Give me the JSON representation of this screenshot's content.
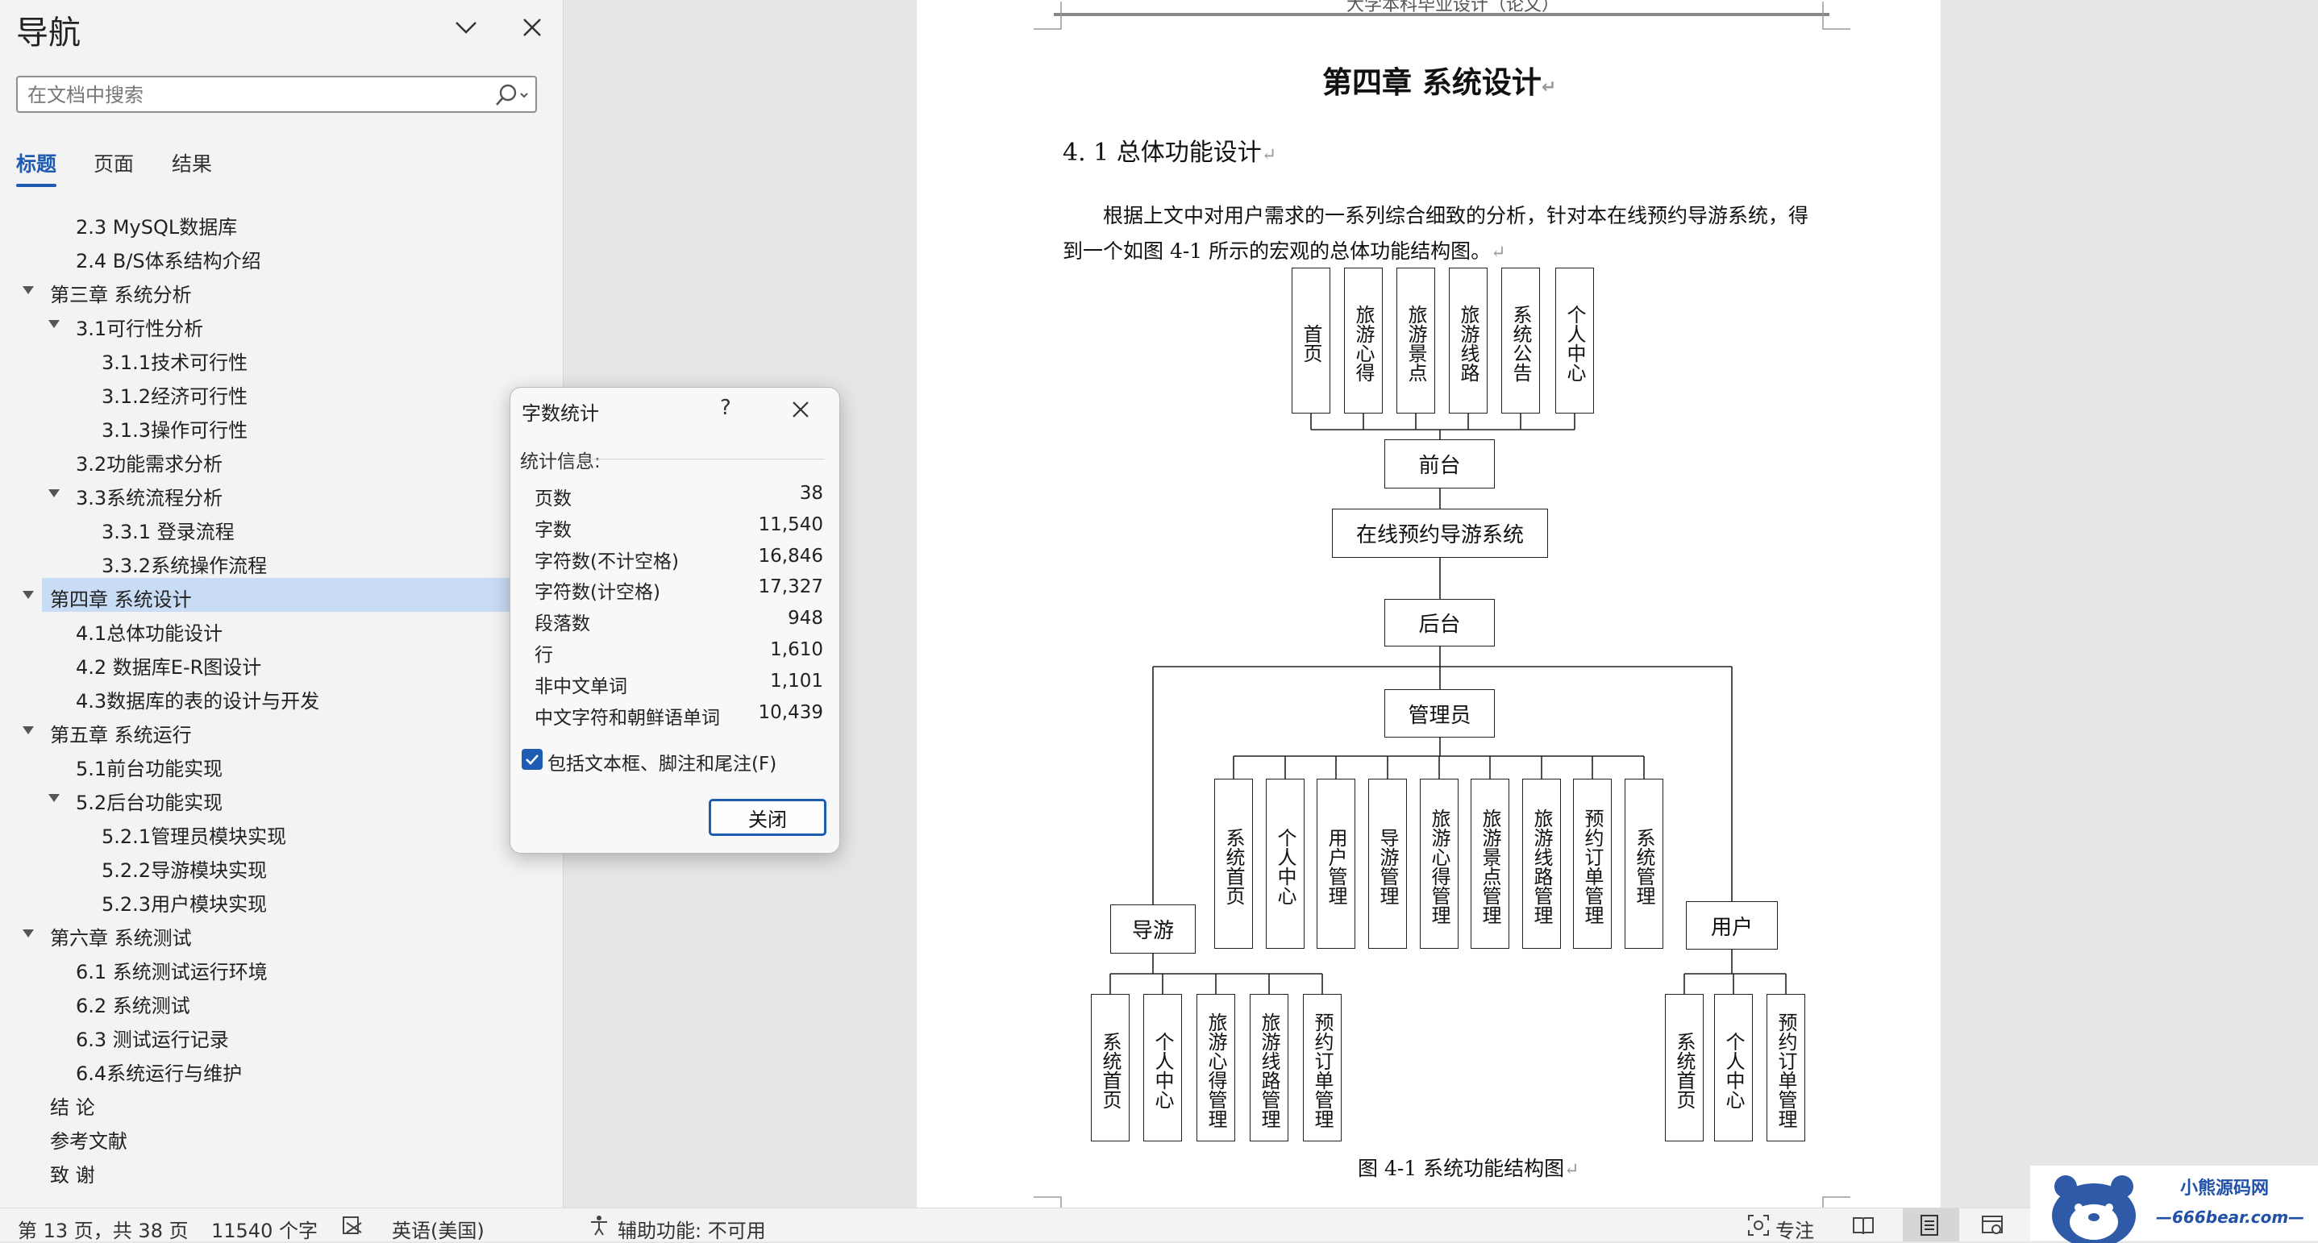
{
  "nav": {
    "title": "导航",
    "search_placeholder": "在文档中搜索",
    "tabs": [
      "标题",
      "页面",
      "结果"
    ],
    "headings": [
      {
        "text": "2.3 MySQL数据库",
        "level": 2,
        "toggle": false,
        "selected": false
      },
      {
        "text": "2.4 B/S体系结构介绍",
        "level": 2,
        "toggle": false,
        "selected": false
      },
      {
        "text": "第三章 系统分析",
        "level": 1,
        "toggle": true,
        "selected": false
      },
      {
        "text": "3.1可行性分析",
        "level": 2,
        "toggle": true,
        "selected": false
      },
      {
        "text": "3.1.1技术可行性",
        "level": 3,
        "toggle": false,
        "selected": false
      },
      {
        "text": "3.1.2经济可行性",
        "level": 3,
        "toggle": false,
        "selected": false
      },
      {
        "text": "3.1.3操作可行性",
        "level": 3,
        "toggle": false,
        "selected": false
      },
      {
        "text": "3.2功能需求分析",
        "level": 2,
        "toggle": false,
        "selected": false
      },
      {
        "text": "3.3系统流程分析",
        "level": 2,
        "toggle": true,
        "selected": false
      },
      {
        "text": "3.3.1 登录流程",
        "level": 3,
        "toggle": false,
        "selected": false
      },
      {
        "text": "3.3.2系统操作流程",
        "level": 3,
        "toggle": false,
        "selected": false
      },
      {
        "text": "第四章 系统设计",
        "level": 1,
        "toggle": true,
        "selected": true
      },
      {
        "text": "4.1总体功能设计",
        "level": 2,
        "toggle": false,
        "selected": false
      },
      {
        "text": "4.2 数据库E-R图设计",
        "level": 2,
        "toggle": false,
        "selected": false
      },
      {
        "text": "4.3数据库的表的设计与开发",
        "level": 2,
        "toggle": false,
        "selected": false
      },
      {
        "text": "第五章 系统运行",
        "level": 1,
        "toggle": true,
        "selected": false
      },
      {
        "text": "5.1前台功能实现",
        "level": 2,
        "toggle": false,
        "selected": false
      },
      {
        "text": "5.2后台功能实现",
        "level": 2,
        "toggle": true,
        "selected": false
      },
      {
        "text": "5.2.1管理员模块实现",
        "level": 3,
        "toggle": false,
        "selected": false
      },
      {
        "text": "5.2.2导游模块实现",
        "level": 3,
        "toggle": false,
        "selected": false
      },
      {
        "text": "5.2.3用户模块实现",
        "level": 3,
        "toggle": false,
        "selected": false
      },
      {
        "text": "第六章 系统测试",
        "level": 1,
        "toggle": true,
        "selected": false
      },
      {
        "text": "6.1 系统测试运行环境",
        "level": 2,
        "toggle": false,
        "selected": false
      },
      {
        "text": "6.2 系统测试",
        "level": 2,
        "toggle": false,
        "selected": false
      },
      {
        "text": "6.3 测试运行记录",
        "level": 2,
        "toggle": false,
        "selected": false
      },
      {
        "text": "6.4系统运行与维护",
        "level": 2,
        "toggle": false,
        "selected": false
      },
      {
        "text": "结 论",
        "level": 1,
        "toggle": false,
        "selected": false
      },
      {
        "text": "参考文献",
        "level": 1,
        "toggle": false,
        "selected": false
      },
      {
        "text": "致 谢",
        "level": 1,
        "toggle": false,
        "selected": false
      }
    ]
  },
  "document": {
    "running_header": "大学本科毕业设计（论文）",
    "chapter_title": "第四章  系统设计",
    "section_title": "4. 1 总体功能设计",
    "paragraph": "根据上文中对用户需求的一系列综合细致的分析，针对本在线预约导游系统，得到一个如图 4-1 所示的宏观的总体功能结构图。",
    "figure_caption": "图 4-1  系统功能结构图",
    "return_mark": "↵"
  },
  "diagram": {
    "front_items": [
      "首页",
      "旅游心得",
      "旅游景点",
      "旅游线路",
      "系统公告",
      "个人中心"
    ],
    "front": "前台",
    "system": "在线预约导游系统",
    "back": "后台",
    "admin": "管理员",
    "admin_items": [
      "系统首页",
      "个人中心",
      "用户管理",
      "导游管理",
      "旅游心得管理",
      "旅游景点管理",
      "旅游线路管理",
      "预约订单管理",
      "系统管理"
    ],
    "guide": "导游",
    "guide_items": [
      "系统首页",
      "个人中心",
      "旅游心得管理",
      "旅游线路管理",
      "预约订单管理"
    ],
    "user": "用户",
    "user_items": [
      "系统首页",
      "个人中心",
      "预约订单管理"
    ]
  },
  "dialog": {
    "title": "字数统计",
    "help": "?",
    "section_label": "统计信息:",
    "stats": [
      {
        "label": "页数",
        "value": "38"
      },
      {
        "label": "字数",
        "value": "11,540"
      },
      {
        "label": "字符数(不计空格)",
        "value": "16,846"
      },
      {
        "label": "字符数(计空格)",
        "value": "17,327"
      },
      {
        "label": "段落数",
        "value": "948"
      },
      {
        "label": "行",
        "value": "1,610"
      },
      {
        "label": "非中文单词",
        "value": "1,101"
      },
      {
        "label": "中文字符和朝鲜语单词",
        "value": "10,439"
      }
    ],
    "checkbox_label": "包括文本框、脚注和尾注(F)",
    "checkbox_checked": true,
    "close_button": "关闭"
  },
  "status": {
    "page": "第 13 页，共 38 页",
    "words": "11540 个字",
    "language": "英语(美国)",
    "accessibility": "辅助功能: 不可用",
    "focus": "专注"
  },
  "watermark": {
    "name": "小熊源码网",
    "url": "—666bear.com—"
  },
  "colors": {
    "accent": "#1e5cb3",
    "nav_bg": "#f3f3f3",
    "selected_bg": "#c9dcf5"
  }
}
